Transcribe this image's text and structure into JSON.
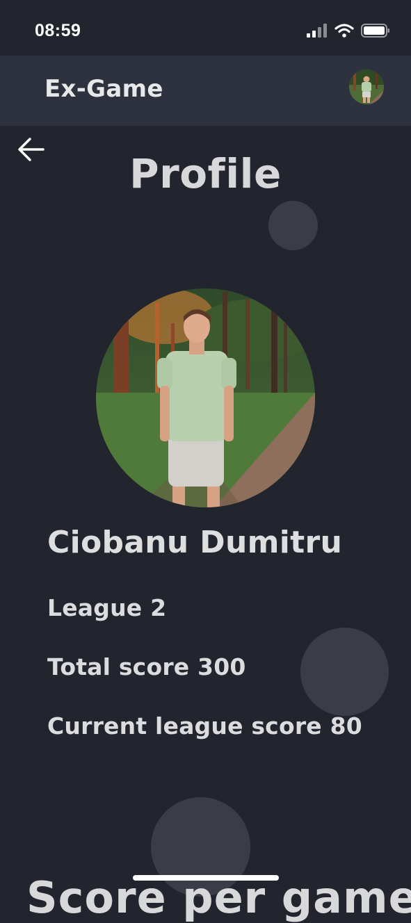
{
  "status_bar": {
    "time": "08:59",
    "icons": [
      "signal-icon",
      "wifi-icon",
      "battery-icon"
    ]
  },
  "header": {
    "app_title": "Ex-Game",
    "avatar_icon": "user-avatar"
  },
  "page": {
    "back_icon": "arrow-left-icon",
    "title": "Profile"
  },
  "profile": {
    "name": "Ciobanu Dumitru",
    "league": "League 2",
    "total_score": "Total score 300",
    "current_league_score": "Current league score 80"
  },
  "sections": {
    "score_per_game": "Score per game"
  },
  "colors": {
    "background": "#22252d",
    "header": "#2e323e",
    "bubble": "#3a3d47",
    "text": "#dcdcdf"
  }
}
